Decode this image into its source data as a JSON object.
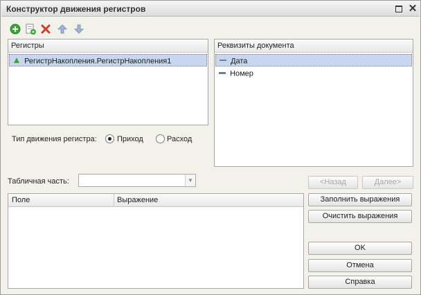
{
  "window": {
    "title": "Конструктор движения регистров"
  },
  "toolbar": {
    "icons": [
      "add-icon",
      "copy-add-icon",
      "delete-icon",
      "arrow-up-icon",
      "arrow-down-icon"
    ]
  },
  "registers": {
    "header": "Регистры",
    "items": [
      {
        "label": "РегистрНакопления.РегистрНакопления1",
        "selected": true
      }
    ]
  },
  "attributes": {
    "header": "Реквизиты документа",
    "items": [
      {
        "label": "Дата",
        "selected": true
      },
      {
        "label": "Номер",
        "selected": false
      }
    ]
  },
  "movement_type": {
    "label": "Тип движения регистра:",
    "options": [
      {
        "label": "Приход",
        "selected": true
      },
      {
        "label": "Расход",
        "selected": false
      }
    ]
  },
  "tabular": {
    "label": "Табличная часть:",
    "value": ""
  },
  "nav": {
    "back": "<Назад",
    "next": "Далее>"
  },
  "grid": {
    "columns": [
      "Поле",
      "Выражение"
    ]
  },
  "actions": {
    "fill": "Заполнить выражения",
    "clear": "Очистить выражения",
    "ok": "OK",
    "cancel": "Отмена",
    "help": "Справка"
  },
  "colors": {
    "selection": "#c8d7ef",
    "add_green": "#3aa63a",
    "delete_red": "#d23a2e",
    "arrow_blue": "#9db6d6"
  }
}
